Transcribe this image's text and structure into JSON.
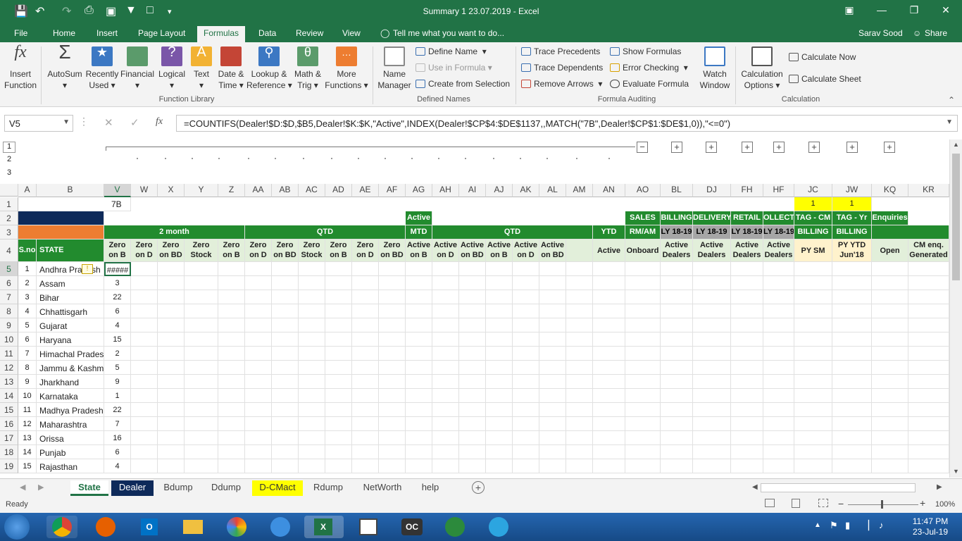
{
  "title": "Summary 1 23.07.2019 - Excel",
  "tabs": [
    "File",
    "Home",
    "Insert",
    "Page Layout",
    "Formulas",
    "Data",
    "Review",
    "View"
  ],
  "tell_me": "Tell me what you want to do...",
  "user": "Sarav Sood",
  "share": "Share",
  "ribbon": {
    "insert_function": [
      "Insert",
      "Function"
    ],
    "autosum": "AutoSum",
    "recently_used": [
      "Recently",
      "Used"
    ],
    "financial": "Financial",
    "logical": "Logical",
    "text": "Text",
    "date_time": [
      "Date &",
      "Time"
    ],
    "lookup": [
      "Lookup &",
      "Reference"
    ],
    "math": [
      "Math &",
      "Trig"
    ],
    "more": [
      "More",
      "Functions"
    ],
    "group_function_library": "Function Library",
    "name_manager": [
      "Name",
      "Manager"
    ],
    "define_name": "Define Name",
    "use_in_formula": "Use in Formula",
    "create_from_selection": "Create from Selection",
    "group_defined_names": "Defined Names",
    "trace_precedents": "Trace Precedents",
    "trace_dependents": "Trace Dependents",
    "remove_arrows": "Remove Arrows",
    "show_formulas": "Show Formulas",
    "error_checking": "Error Checking",
    "evaluate_formula": "Evaluate Formula",
    "group_formula_auditing": "Formula Auditing",
    "watch_window": [
      "Watch",
      "Window"
    ],
    "calc_options": [
      "Calculation",
      "Options"
    ],
    "calculate_now": "Calculate Now",
    "calculate_sheet": "Calculate Sheet",
    "group_calculation": "Calculation"
  },
  "name_box": "V5",
  "formula": "=COUNTIFS(Dealer!$D:$D,$B5,Dealer!$K:$K,\"Active\",INDEX(Dealer!$CP$4:$DE$1137,,MATCH(\"7B\",Dealer!$CP$1:$DE$1,0)),\"<=0\")",
  "outline_levels": [
    "1",
    "2",
    "3"
  ],
  "columns": [
    "A",
    "B",
    "V",
    "W",
    "X",
    "Y",
    "Z",
    "AA",
    "AB",
    "AC",
    "AD",
    "AE",
    "AF",
    "AG",
    "AH",
    "AI",
    "AJ",
    "AK",
    "AL",
    "AM",
    "AN",
    "AO",
    "BL",
    "DJ",
    "FH",
    "HF",
    "JC",
    "JW",
    "KQ",
    "KR"
  ],
  "row1": {
    "V": "7B",
    "JC": "1",
    "JW": "1"
  },
  "row2": {
    "AG": "Active",
    "AO": "SALES",
    "BL": "BILLING",
    "DJ": "DELIVERY",
    "FH": "RETAIL",
    "HF": "OLLECTIO",
    "JC": "TAG - CM",
    "JW": "TAG - Yr",
    "KQ": "Enquiries"
  },
  "row3": {
    "twomonth": "2 month",
    "qtd1": "QTD",
    "mtd": "MTD",
    "qtd2": "QTD",
    "ytd": "YTD",
    "AO": "RM/AM",
    "BL": "LY 18-19",
    "DJ": "LY 18-19",
    "FH": "LY 18-19",
    "HF": "LY 18-19",
    "JC": "BILLING",
    "JW": "BILLING"
  },
  "row4": {
    "A": "S.no",
    "B": "STATE",
    "V": "Zero on B",
    "W": "Zero on D",
    "X": "Zero on BD",
    "Y": "Zero Stock",
    "Z": "Zero on B",
    "AA": "Zero on D",
    "AB": "Zero on BD",
    "AC": "Zero Stock",
    "AD": "Zero on B",
    "AE": "Zero on D",
    "AF": "Zero on BD",
    "AG": "Active on B",
    "AH": "Active on D",
    "AI": "Active on BD",
    "AJ": "Active on B",
    "AK": "Active on D",
    "AL": "Active on BD",
    "AM": "",
    "AN": "Active",
    "AO": "Onboard",
    "BL": "Active Dealers",
    "DJ": "Active Dealers",
    "FH": "Active Dealers",
    "HF": "Active Dealers",
    "JC": "PY SM",
    "JW": "PY YTD Jun'18",
    "KQ": "Open",
    "KR": "CM enq. Generated"
  },
  "rows": [
    {
      "n": "5",
      "sno": "1",
      "state": "Andhra Pradesh",
      "v": "#####"
    },
    {
      "n": "6",
      "sno": "2",
      "state": "Assam",
      "v": "3"
    },
    {
      "n": "7",
      "sno": "3",
      "state": "Bihar",
      "v": "22"
    },
    {
      "n": "8",
      "sno": "4",
      "state": "Chhattisgarh",
      "v": "6"
    },
    {
      "n": "9",
      "sno": "5",
      "state": "Gujarat",
      "v": "4"
    },
    {
      "n": "10",
      "sno": "6",
      "state": "Haryana",
      "v": "15"
    },
    {
      "n": "11",
      "sno": "7",
      "state": "Himachal Pradesh",
      "v": "2"
    },
    {
      "n": "12",
      "sno": "8",
      "state": "Jammu & Kashmir",
      "v": "5"
    },
    {
      "n": "13",
      "sno": "9",
      "state": "Jharkhand",
      "v": "9"
    },
    {
      "n": "14",
      "sno": "10",
      "state": "Karnataka",
      "v": "1"
    },
    {
      "n": "15",
      "sno": "11",
      "state": "Madhya Pradesh",
      "v": "22"
    },
    {
      "n": "16",
      "sno": "12",
      "state": "Maharashtra",
      "v": "7"
    },
    {
      "n": "17",
      "sno": "13",
      "state": "Orissa",
      "v": "16"
    },
    {
      "n": "18",
      "sno": "14",
      "state": "Punjab",
      "v": "6"
    },
    {
      "n": "19",
      "sno": "15",
      "state": "Rajasthan",
      "v": "4"
    }
  ],
  "sheets": [
    {
      "name": "State",
      "style": "active"
    },
    {
      "name": "Dealer",
      "style": "navy"
    },
    {
      "name": "Bdump",
      "style": "plain"
    },
    {
      "name": "Ddump",
      "style": "plain"
    },
    {
      "name": "D-CMact",
      "style": "yellow"
    },
    {
      "name": "Rdump",
      "style": "plain"
    },
    {
      "name": "NetWorth",
      "style": "plain"
    },
    {
      "name": "help",
      "style": "plain"
    }
  ],
  "status_text": "Ready",
  "zoom": "100%",
  "clock": {
    "time": "11:47 PM",
    "date": "23-Jul-19"
  },
  "colors": {
    "excel_green": "#217346",
    "header_green": "#228b2e",
    "orange": "#ed7d31",
    "navy": "#0e2a5a",
    "yellow": "#ffff00",
    "light_green": "#e2efda"
  }
}
